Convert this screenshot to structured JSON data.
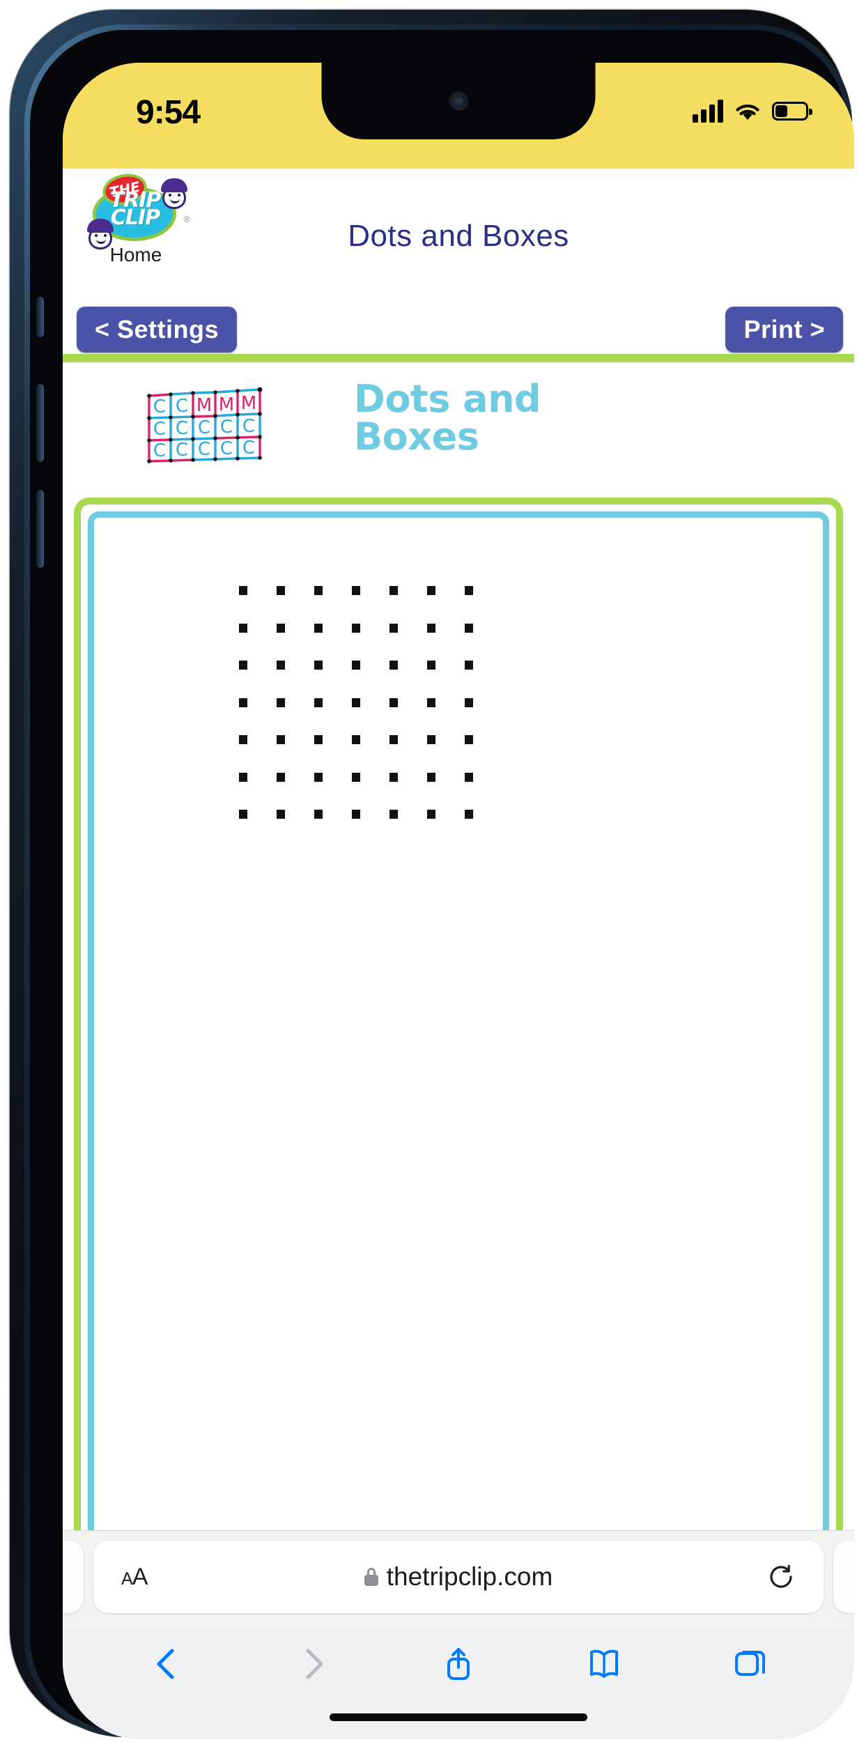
{
  "status_bar": {
    "time": "9:54",
    "cellular_icon": "signal-bars-icon",
    "wifi_icon": "wifi-icon",
    "battery_icon": "battery-icon",
    "background_color": "#f5dd5f"
  },
  "site_header": {
    "logo": {
      "icon": "trip-clip-logo",
      "the_text": "THE",
      "line1": "TRIP",
      "line2": "CLIP",
      "trademark": "®"
    },
    "home_label": "Home",
    "page_title": "Dots and Boxes",
    "title_color": "#2a2f86"
  },
  "nav": {
    "settings_label": "< Settings",
    "print_label": "Print >",
    "button_color": "#4a53a8",
    "rule_color": "#a8d84f"
  },
  "puzzle": {
    "title_line1": "Dots and",
    "title_line2": "Boxes",
    "title_color": "#6fcbe0",
    "icon_name": "dots-and-boxes-icon",
    "icon_letters": [
      [
        "C",
        "C",
        "M",
        "M",
        "M"
      ],
      [
        "C",
        "C",
        "C",
        "C",
        "C"
      ],
      [
        "C",
        "C",
        "C",
        "C",
        "C"
      ]
    ],
    "icon_colors": {
      "player_c": "#29a8dc",
      "player_m": "#d8246b"
    },
    "frame_outer_color": "#a8d84f",
    "frame_inner_color": "#6fcbe0",
    "grid": {
      "rows": 7,
      "cols": 7,
      "dot_color": "#111111"
    }
  },
  "safari": {
    "aa_label_small": "A",
    "aa_label_large": "A",
    "lock_icon": "lock-icon",
    "url": "thetripclip.com",
    "reload_icon": "reload-icon",
    "toolbar": [
      {
        "icon": "back-chevron-icon",
        "enabled": true
      },
      {
        "icon": "forward-chevron-icon",
        "enabled": false
      },
      {
        "icon": "share-icon",
        "enabled": true
      },
      {
        "icon": "bookmarks-book-icon",
        "enabled": true
      },
      {
        "icon": "tabs-icon",
        "enabled": true
      }
    ],
    "accent_color": "#007aff",
    "home_indicator": "home-indicator"
  }
}
